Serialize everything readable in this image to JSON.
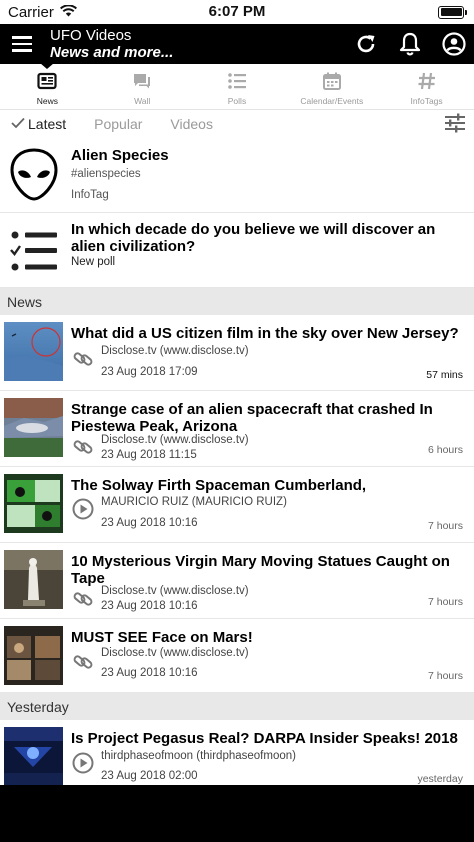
{
  "status": {
    "carrier": "Carrier",
    "time": "6:07 PM"
  },
  "header": {
    "title": "UFO Videos",
    "subtitle": "News and more..."
  },
  "tabs": [
    {
      "label": "News",
      "icon": "newspaper-icon",
      "active": true
    },
    {
      "label": "Wall",
      "icon": "chat-icon",
      "active": false
    },
    {
      "label": "Polls",
      "icon": "list-icon",
      "active": false
    },
    {
      "label": "Calendar/Events",
      "icon": "calendar-icon",
      "active": false
    },
    {
      "label": "InfoTags",
      "icon": "hashtag-icon",
      "active": false
    }
  ],
  "filters": {
    "latest": "Latest",
    "popular": "Popular",
    "videos": "Videos"
  },
  "infotag": {
    "title": "Alien Species",
    "tag": "#alienspecies",
    "type": "InfoTag"
  },
  "poll": {
    "title": "In which decade do you believe we will discover an alien civilization?",
    "type": "New poll"
  },
  "sections": {
    "news": "News",
    "yesterday": "Yesterday"
  },
  "news": [
    {
      "title": "What did a US citizen film in the sky over New Jersey?",
      "source": "Disclose.tv (www.disclose.tv)",
      "date": "23 Aug 2018 17:09",
      "ago": "57 mins",
      "kind": "link-icon"
    },
    {
      "title": "Strange case of an alien spacecraft that crashed In Piestewa Peak, Arizona",
      "source": "Disclose.tv (www.disclose.tv)",
      "date": "23 Aug 2018 11:15",
      "ago": "6 hours",
      "kind": "link-icon"
    },
    {
      "title": "The Solway Firth Spaceman  Cumberland,",
      "source": "MAURICIO RUIZ (MAURICIO RUIZ)",
      "date": "23 Aug 2018 10:16",
      "ago": "7 hours",
      "kind": "play-icon"
    },
    {
      "title": "10 Mysterious Virgin Mary Moving Statues Caught on Tape",
      "source": "Disclose.tv (www.disclose.tv)",
      "date": "23 Aug 2018 10:16",
      "ago": "7 hours",
      "kind": "link-icon"
    },
    {
      "title": "MUST SEE Face on Mars!",
      "source": "Disclose.tv (www.disclose.tv)",
      "date": "23 Aug 2018 10:16",
      "ago": "7 hours",
      "kind": "link-icon"
    }
  ],
  "yesterday": [
    {
      "title": "Is Project Pegasus Real? DARPA Insider Speaks! 2018",
      "source": "thirdphaseofmoon (thirdphaseofmoon)",
      "date": "23 Aug 2018 02:00",
      "ago": "yesterday",
      "kind": "play-icon"
    }
  ]
}
